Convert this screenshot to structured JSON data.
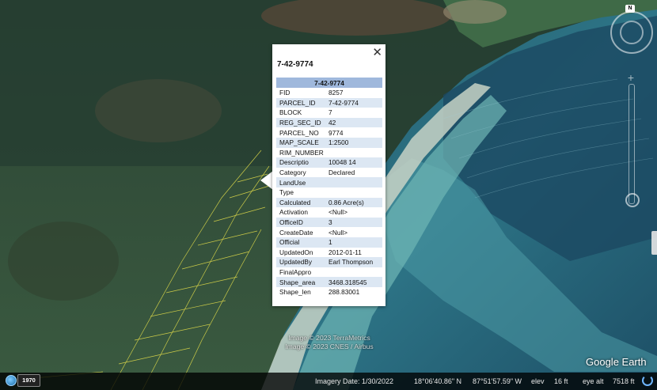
{
  "popup": {
    "title": "7-42-9774",
    "close_icon": "close-icon",
    "table_header": "7-42-9774",
    "rows": [
      {
        "key": "FID",
        "value": "8257"
      },
      {
        "key": "PARCEL_ID",
        "value": "7-42-9774"
      },
      {
        "key": "BLOCK",
        "value": "7"
      },
      {
        "key": "REG_SEC_ID",
        "value": "42"
      },
      {
        "key": "PARCEL_NO",
        "value": "9774"
      },
      {
        "key": "MAP_SCALE",
        "value": "1:2500"
      },
      {
        "key": "RIM_NUMBER",
        "value": ""
      },
      {
        "key": "Descriptio",
        "value": "10048 14"
      },
      {
        "key": "Category",
        "value": "Declared"
      },
      {
        "key": "LandUse",
        "value": ""
      },
      {
        "key": "Type",
        "value": ""
      },
      {
        "key": "Calculated",
        "value": "0.86 Acre(s)"
      },
      {
        "key": "Activation",
        "value": "<Null>"
      },
      {
        "key": "OfficeID",
        "value": "3"
      },
      {
        "key": "CreateDate",
        "value": "<Null>"
      },
      {
        "key": "Official",
        "value": "1"
      },
      {
        "key": "UpdatedOn",
        "value": "2012-01-11"
      },
      {
        "key": "UpdatedBy",
        "value": "Earl Thompson"
      },
      {
        "key": "FinalAppro",
        "value": ""
      },
      {
        "key": "Shape_area",
        "value": "3468.318545"
      },
      {
        "key": "Shape_len",
        "value": "288.83001"
      }
    ]
  },
  "attribution": {
    "line1": "Image © 2023 TerraMetrics",
    "line2": "Image © 2023 CNES / Airbus"
  },
  "logo": "Google Earth",
  "navigation": {
    "north_label": "N"
  },
  "status_bar": {
    "year": "1970",
    "imagery_date": "Imagery Date: 1/30/2022",
    "latitude": "18°06'40.86\" N",
    "longitude": "87°51'57.59\" W",
    "elev_label": "elev",
    "elev_value": "16 ft",
    "eye_alt_label": "eye alt",
    "eye_alt_value": "7518 ft"
  },
  "colors": {
    "table_header": "#9fb8dc",
    "table_alt_row": "#dce7f3",
    "land": "#2f4a36",
    "water": "#2b6f80",
    "parcel_lines": "#e6e04a"
  }
}
